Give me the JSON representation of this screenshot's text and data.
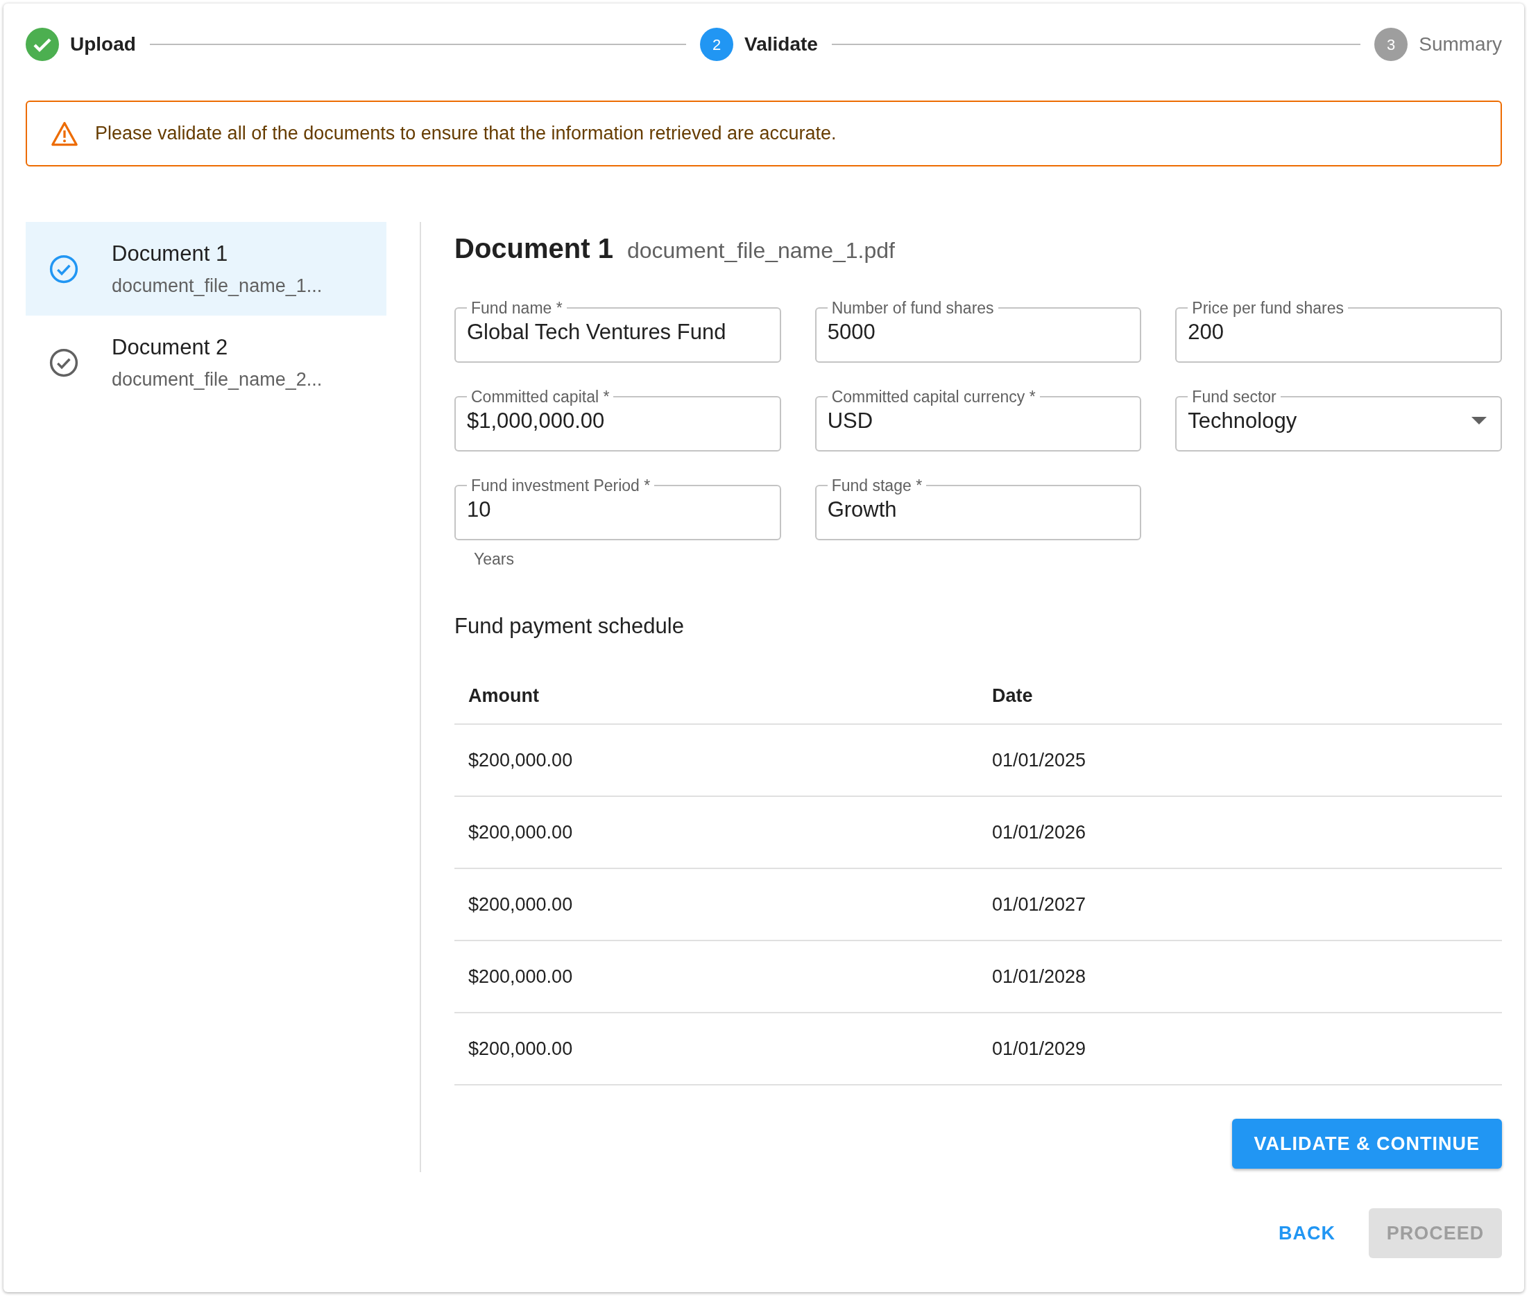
{
  "steps": [
    {
      "kind": "completed",
      "label": "Upload"
    },
    {
      "kind": "active",
      "number": "2",
      "label": "Validate"
    },
    {
      "kind": "pending",
      "number": "3",
      "label": "Summary"
    }
  ],
  "alert": {
    "message": "Please validate all of the documents to ensure that the information retrieved are accurate."
  },
  "documents": [
    {
      "title": "Document 1",
      "filename": "document_file_name_1...",
      "selected": true
    },
    {
      "title": "Document 2",
      "filename": "document_file_name_2...",
      "selected": false
    }
  ],
  "form": {
    "title": "Document 1",
    "filename": "document_file_name_1.pdf",
    "fields": [
      {
        "kind": "text",
        "label": "Fund name *",
        "value": "Global Tech Ventures Fund"
      },
      {
        "kind": "text",
        "label": "Number of fund shares",
        "value": "5000"
      },
      {
        "kind": "text",
        "label": "Price per fund shares",
        "value": "200"
      },
      {
        "kind": "text",
        "label": "Committed capital *",
        "value": "$1,000,000.00"
      },
      {
        "kind": "text",
        "label": "Committed capital currency *",
        "value": "USD"
      },
      {
        "kind": "select",
        "label": "Fund sector",
        "value": "Technology"
      },
      {
        "kind": "text",
        "label": "Fund investment Period *",
        "value": "10",
        "helper": "Years"
      },
      {
        "kind": "text",
        "label": "Fund stage *",
        "value": "Growth"
      }
    ]
  },
  "schedule": {
    "title": "Fund payment schedule",
    "columns": [
      "Amount",
      "Date"
    ],
    "rows": [
      [
        "$200,000.00",
        "01/01/2025"
      ],
      [
        "$200,000.00",
        "01/01/2026"
      ],
      [
        "$200,000.00",
        "01/01/2027"
      ],
      [
        "$200,000.00",
        "01/01/2028"
      ],
      [
        "$200,000.00",
        "01/01/2029"
      ]
    ]
  },
  "validate_button": {
    "label": "VALIDATE & CONTINUE"
  },
  "back_button": {
    "label": "BACK"
  },
  "proceed_button": {
    "label": "PROCEED",
    "disabled": true
  }
}
